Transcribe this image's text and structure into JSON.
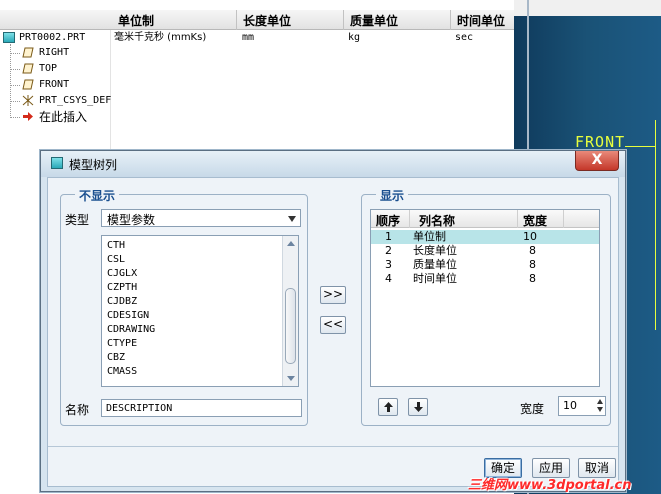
{
  "tree": {
    "columns": [
      "单位制",
      "长度单位",
      "质量单位",
      "时间单位"
    ],
    "root": {
      "label": "PRT0002.PRT",
      "cells": [
        "毫米千克秒 (mmKs)",
        "mm",
        "kg",
        "sec"
      ]
    },
    "items": [
      {
        "label": "RIGHT",
        "icon": "datum-plane-icon"
      },
      {
        "label": "TOP",
        "icon": "datum-plane-icon"
      },
      {
        "label": "FRONT",
        "icon": "datum-plane-icon"
      },
      {
        "label": "PRT_CSYS_DEF",
        "icon": "coordinate-system-icon"
      },
      {
        "label": "在此插入",
        "icon": "insert-here-arrow-icon"
      }
    ]
  },
  "viewport": {
    "front_label": "FRONT"
  },
  "dialog": {
    "title": "模型树列",
    "close_label": "X",
    "hidden_group": {
      "title": "不显示",
      "type_label": "类型",
      "type_value": "模型参数",
      "items": [
        "CTH",
        "CSL",
        "CJGLX",
        "CZPTH",
        "CJDBZ",
        "CDESIGN",
        "CDRAWING",
        "CTYPE",
        "CBZ",
        "CMASS"
      ],
      "name_label": "名称",
      "name_value": "DESCRIPTION"
    },
    "move_right_label": ">>",
    "move_left_label": "<<",
    "shown_group": {
      "title": "显示",
      "headers": [
        "顺序",
        "列名称",
        "宽度"
      ],
      "rows": [
        {
          "order": "1",
          "name": "单位制",
          "width": "10"
        },
        {
          "order": "2",
          "name": "长度单位",
          "width": "8"
        },
        {
          "order": "3",
          "name": "质量单位",
          "width": "8"
        },
        {
          "order": "4",
          "name": "时间单位",
          "width": "8"
        }
      ],
      "selected_row": 0,
      "width_label": "宽度",
      "width_value": "10"
    },
    "buttons": {
      "ok": "确定",
      "apply": "应用",
      "cancel": "取消"
    }
  },
  "watermark": "三维网www.3dportal.cn",
  "colors": {
    "group_title": "#1a4f8f",
    "selected_row": "#b8e4e8",
    "viewport_bg": "#1a5276",
    "front_label": "#e8ff3d",
    "close_button": "#c4372a",
    "watermark": "#ff2a2a"
  }
}
